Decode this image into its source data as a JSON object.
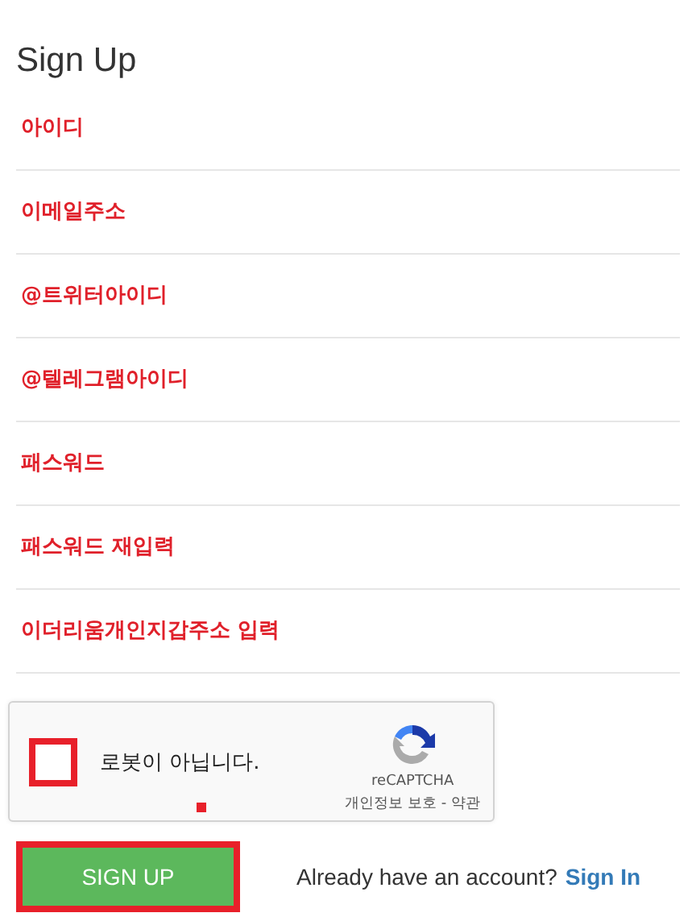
{
  "title": "Sign Up",
  "fields": [
    {
      "placeholder": "아이디"
    },
    {
      "placeholder": "이메일주소"
    },
    {
      "placeholder": "@트위터아이디"
    },
    {
      "placeholder": "@텔레그램아이디"
    },
    {
      "placeholder": "패스워드"
    },
    {
      "placeholder": "패스워드 재입력"
    },
    {
      "placeholder": "이더리움개인지갑주소 입력"
    }
  ],
  "captcha": {
    "checked": false,
    "label": "로봇이 아닙니다.",
    "brand": "reCAPTCHA",
    "links": "개인정보 보호 - 약관"
  },
  "submit": "SIGN UP",
  "signin": {
    "prompt": "Already have an account?",
    "link": "Sign In"
  }
}
